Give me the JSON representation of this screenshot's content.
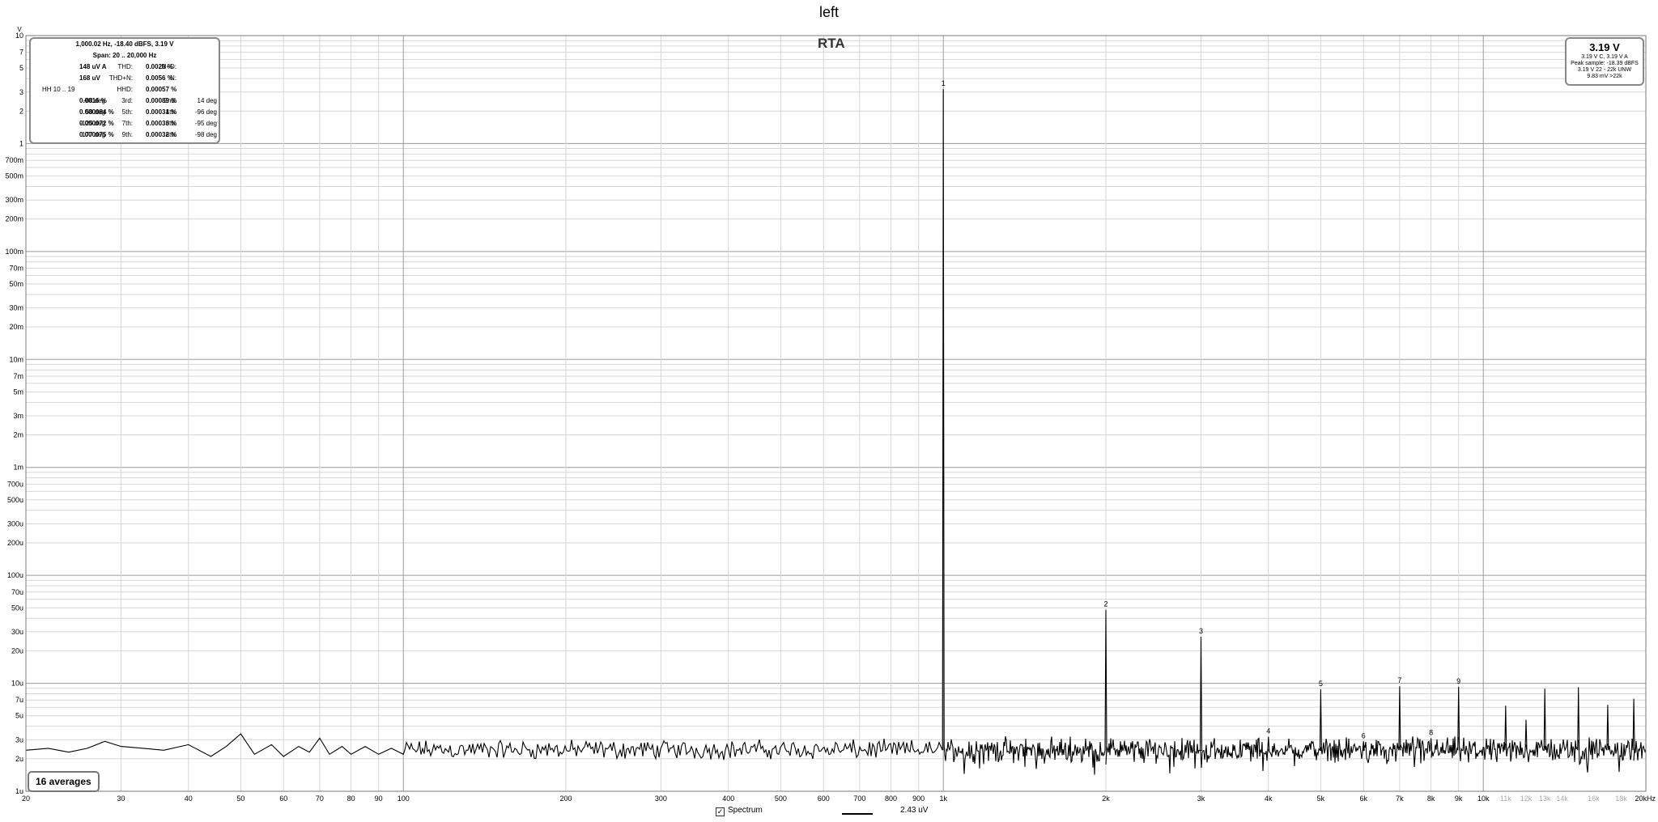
{
  "title": "left",
  "rta_label": "RTA",
  "stats_box": {
    "header1": "1,000.02 Hz, -18.40 dBFS, 3.19 V",
    "header2": "Span: 20 .. 20,000 Hz",
    "rows": [
      {
        "l1": "N+D:",
        "v1": "148 uV A",
        "p1": "",
        "l2": "THD:",
        "v2": "0.0020 %",
        "p2": ""
      },
      {
        "l1": "N:",
        "v1": "168 uV",
        "p1": "",
        "l2": "THD+N:",
        "v2": "0.0056 %",
        "p2": ""
      },
      {
        "l1": "HH 10 .. 19",
        "v1": "",
        "p1": "",
        "l2": "HHD:",
        "v2": "0.00057 %",
        "p2": ""
      },
      {
        "l1": "2nd:",
        "v1": "0.0016 %",
        "p1": "-88 deg",
        "l2": "3rd:",
        "v2": "0.00089 %",
        "p2": "14 deg"
      },
      {
        "l1": "4th:",
        "v1": "0.000084 %",
        "p1": "58 deg",
        "l2": "5th:",
        "v2": "0.00031 %",
        "p2": "-96 deg"
      },
      {
        "l1": "6th:",
        "v1": "0.000072 %",
        "p1": "-125 deg",
        "l2": "7th:",
        "v2": "0.00033 %",
        "p2": "-95 deg"
      },
      {
        "l1": "8th:",
        "v1": "0.000075 %",
        "p1": "177 deg",
        "l2": "9th:",
        "v2": "0.00032 %",
        "p2": "-98 deg"
      }
    ]
  },
  "level_box": {
    "main": "3.19 V",
    "line1": "3.19 V C, 3.19 V A",
    "line2": "Peak sample: -18.39 dBFS",
    "line3": "3.19 V 22 - 22k UNW",
    "line4": "9.83 mV >22k"
  },
  "averages_label": "16 averages",
  "legend": {
    "checkbox_mark": "✓",
    "spectrum_label": "Spectrum",
    "value_label": "2.43 uV"
  },
  "colors": {
    "background": "#ffffff",
    "trace": "#000000",
    "grid_major": "#9a9a9a",
    "grid_minor": "#d6d6d6",
    "label_light": "#a8a8a8"
  },
  "chart_data": {
    "type": "line",
    "title": "left",
    "xlabel": "",
    "ylabel": "V",
    "x_scale": "log",
    "y_scale": "log",
    "xlim": [
      20,
      20000
    ],
    "ylim": [
      1e-06,
      10
    ],
    "grid": true,
    "x_ticks": [
      {
        "v": 20,
        "t": "20"
      },
      {
        "v": 30,
        "t": "30"
      },
      {
        "v": 40,
        "t": "40"
      },
      {
        "v": 50,
        "t": "50"
      },
      {
        "v": 60,
        "t": "60"
      },
      {
        "v": 70,
        "t": "70"
      },
      {
        "v": 80,
        "t": "80"
      },
      {
        "v": 90,
        "t": "90"
      },
      {
        "v": 100,
        "t": "100"
      },
      {
        "v": 200,
        "t": "200"
      },
      {
        "v": 300,
        "t": "300"
      },
      {
        "v": 400,
        "t": "400"
      },
      {
        "v": 500,
        "t": "500"
      },
      {
        "v": 600,
        "t": "600"
      },
      {
        "v": 700,
        "t": "700"
      },
      {
        "v": 800,
        "t": "800"
      },
      {
        "v": 900,
        "t": "900"
      },
      {
        "v": 1000,
        "t": "1k"
      },
      {
        "v": 2000,
        "t": "2k"
      },
      {
        "v": 3000,
        "t": "3k"
      },
      {
        "v": 4000,
        "t": "4k"
      },
      {
        "v": 5000,
        "t": "5k"
      },
      {
        "v": 6000,
        "t": "6k"
      },
      {
        "v": 7000,
        "t": "7k"
      },
      {
        "v": 8000,
        "t": "8k"
      },
      {
        "v": 9000,
        "t": "9k"
      },
      {
        "v": 10000,
        "t": "10k"
      },
      {
        "v": 11000,
        "t": "11k",
        "light": true
      },
      {
        "v": 12000,
        "t": "12k",
        "light": true
      },
      {
        "v": 13000,
        "t": "13k",
        "light": true
      },
      {
        "v": 14000,
        "t": "14k",
        "light": true
      },
      {
        "v": 16000,
        "t": "16k",
        "light": true
      },
      {
        "v": 18000,
        "t": "18k",
        "light": true
      },
      {
        "v": 20000,
        "t": "20kHz"
      }
    ],
    "y_ticks": [
      {
        "v": 10,
        "t": "10"
      },
      {
        "v": 7,
        "t": "7"
      },
      {
        "v": 5,
        "t": "5"
      },
      {
        "v": 3,
        "t": "3"
      },
      {
        "v": 2,
        "t": "2"
      },
      {
        "v": 1,
        "t": "1"
      },
      {
        "v": 0.7,
        "t": "700m"
      },
      {
        "v": 0.5,
        "t": "500m"
      },
      {
        "v": 0.3,
        "t": "300m"
      },
      {
        "v": 0.2,
        "t": "200m"
      },
      {
        "v": 0.1,
        "t": "100m"
      },
      {
        "v": 0.07,
        "t": "70m"
      },
      {
        "v": 0.05,
        "t": "50m"
      },
      {
        "v": 0.03,
        "t": "30m"
      },
      {
        "v": 0.02,
        "t": "20m"
      },
      {
        "v": 0.01,
        "t": "10m"
      },
      {
        "v": 0.007,
        "t": "7m"
      },
      {
        "v": 0.005,
        "t": "5m"
      },
      {
        "v": 0.003,
        "t": "3m"
      },
      {
        "v": 0.002,
        "t": "2m"
      },
      {
        "v": 0.001,
        "t": "1m"
      },
      {
        "v": 0.0007,
        "t": "700u"
      },
      {
        "v": 0.0005,
        "t": "500u"
      },
      {
        "v": 0.0003,
        "t": "300u"
      },
      {
        "v": 0.0002,
        "t": "200u"
      },
      {
        "v": 0.0001,
        "t": "100u"
      },
      {
        "v": 7e-05,
        "t": "70u"
      },
      {
        "v": 5e-05,
        "t": "50u"
      },
      {
        "v": 3e-05,
        "t": "30u"
      },
      {
        "v": 2e-05,
        "t": "20u"
      },
      {
        "v": 1e-05,
        "t": "10u"
      },
      {
        "v": 7e-06,
        "t": "7u"
      },
      {
        "v": 5e-06,
        "t": "5u"
      },
      {
        "v": 3e-06,
        "t": "3u"
      },
      {
        "v": 2e-06,
        "t": "2u"
      },
      {
        "v": 1e-06,
        "t": "1u"
      }
    ],
    "noise_floor": {
      "low_freq_points": [
        [
          20,
          2.4e-06
        ],
        [
          22,
          2.5e-06
        ],
        [
          24,
          2.3e-06
        ],
        [
          26,
          2.5e-06
        ],
        [
          28,
          2.9e-06
        ],
        [
          30,
          2.6e-06
        ],
        [
          33,
          2.5e-06
        ],
        [
          36,
          2.4e-06
        ],
        [
          40,
          2.7e-06
        ],
        [
          44,
          2.1e-06
        ],
        [
          47,
          2.6e-06
        ],
        [
          50,
          3.4e-06
        ],
        [
          53,
          2.2e-06
        ],
        [
          57,
          2.7e-06
        ],
        [
          60,
          2.1e-06
        ],
        [
          64,
          2.6e-06
        ],
        [
          67,
          2.3e-06
        ],
        [
          70,
          3.1e-06
        ],
        [
          73,
          2.2e-06
        ],
        [
          77,
          2.6e-06
        ],
        [
          80,
          2.2e-06
        ],
        [
          85,
          2.6e-06
        ],
        [
          90,
          2.2e-06
        ],
        [
          95,
          2.5e-06
        ],
        [
          100,
          2.2e-06
        ]
      ],
      "typical": 2.4e-06,
      "spread_low": 1.9e-06,
      "spread_high": 3.1e-06
    },
    "peaks": [
      {
        "label": "1",
        "x": 1000,
        "y": 3.19
      },
      {
        "label": "2",
        "x": 2000,
        "y": 4.8e-05
      },
      {
        "label": "3",
        "x": 3000,
        "y": 2.7e-05
      },
      {
        "label": "4",
        "x": 4000,
        "y": 3.2e-06
      },
      {
        "label": "5",
        "x": 5000,
        "y": 8.8e-06
      },
      {
        "label": "6",
        "x": 6000,
        "y": 2.9e-06
      },
      {
        "label": "7",
        "x": 7000,
        "y": 9.4e-06
      },
      {
        "label": "8",
        "x": 8000,
        "y": 3.1e-06
      },
      {
        "label": "9",
        "x": 9000,
        "y": 9.3e-06
      },
      {
        "label": "",
        "x": 11000,
        "y": 6.2e-06
      },
      {
        "label": "",
        "x": 12000,
        "y": 4.6e-06
      },
      {
        "label": "",
        "x": 13000,
        "y": 8.9e-06
      },
      {
        "label": "",
        "x": 15000,
        "y": 9.2e-06
      },
      {
        "label": "",
        "x": 17000,
        "y": 6.3e-06
      },
      {
        "label": "",
        "x": 19000,
        "y": 7.2e-06
      }
    ]
  }
}
